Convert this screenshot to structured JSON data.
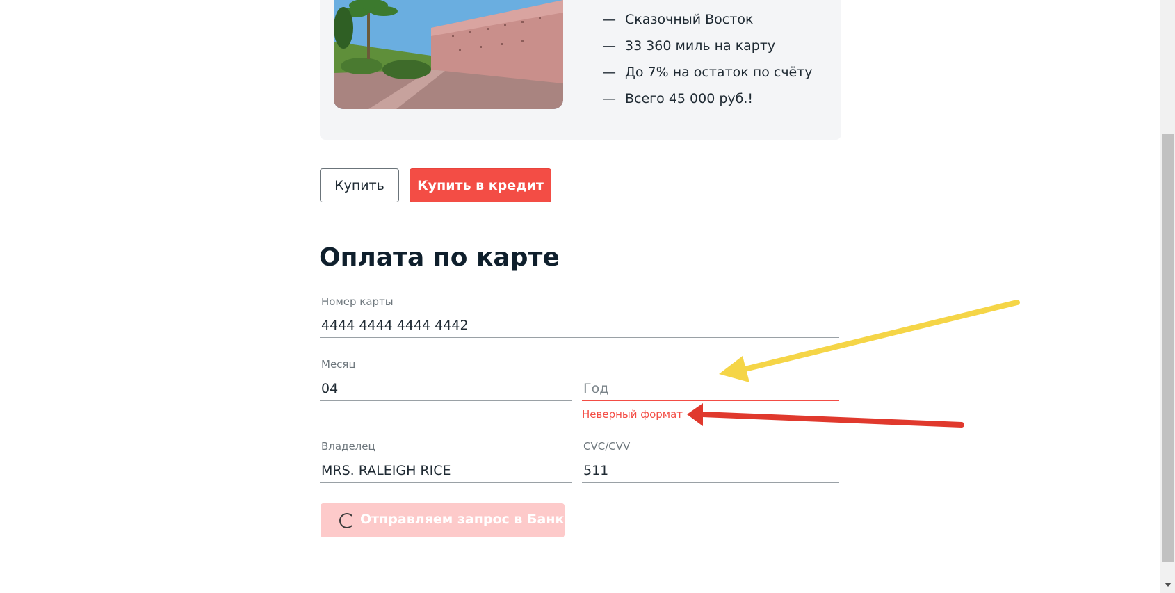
{
  "tour": {
    "image_alt": "Стены медины Марракеша",
    "features": [
      "Сказочный Восток",
      "33 360 миль на карту",
      "До 7% на остаток по счёту",
      "Всего 45 000 руб.!"
    ],
    "dash": "—"
  },
  "actions": {
    "buy_label": "Купить",
    "credit_label": "Купить в кредит"
  },
  "payment": {
    "title": "Оплата по карте",
    "card_number": {
      "label": "Номер карты",
      "value": "4444 4444 4444 4442"
    },
    "month": {
      "label": "Месяц",
      "value": "04"
    },
    "year": {
      "placeholder": "Год",
      "value": "",
      "error": "Неверный формат"
    },
    "owner": {
      "label": "Владелец",
      "value": "MRS. RALEIGH RICE"
    },
    "cvc": {
      "label": "CVC/CVV",
      "value": "511"
    },
    "submit_label": "Отправляем запрос в Банк..."
  },
  "colors": {
    "accent": "#f34d45",
    "submit_disabled": "#fdcaca",
    "annotation_yellow": "#f5d547",
    "annotation_red": "#e0392d"
  }
}
